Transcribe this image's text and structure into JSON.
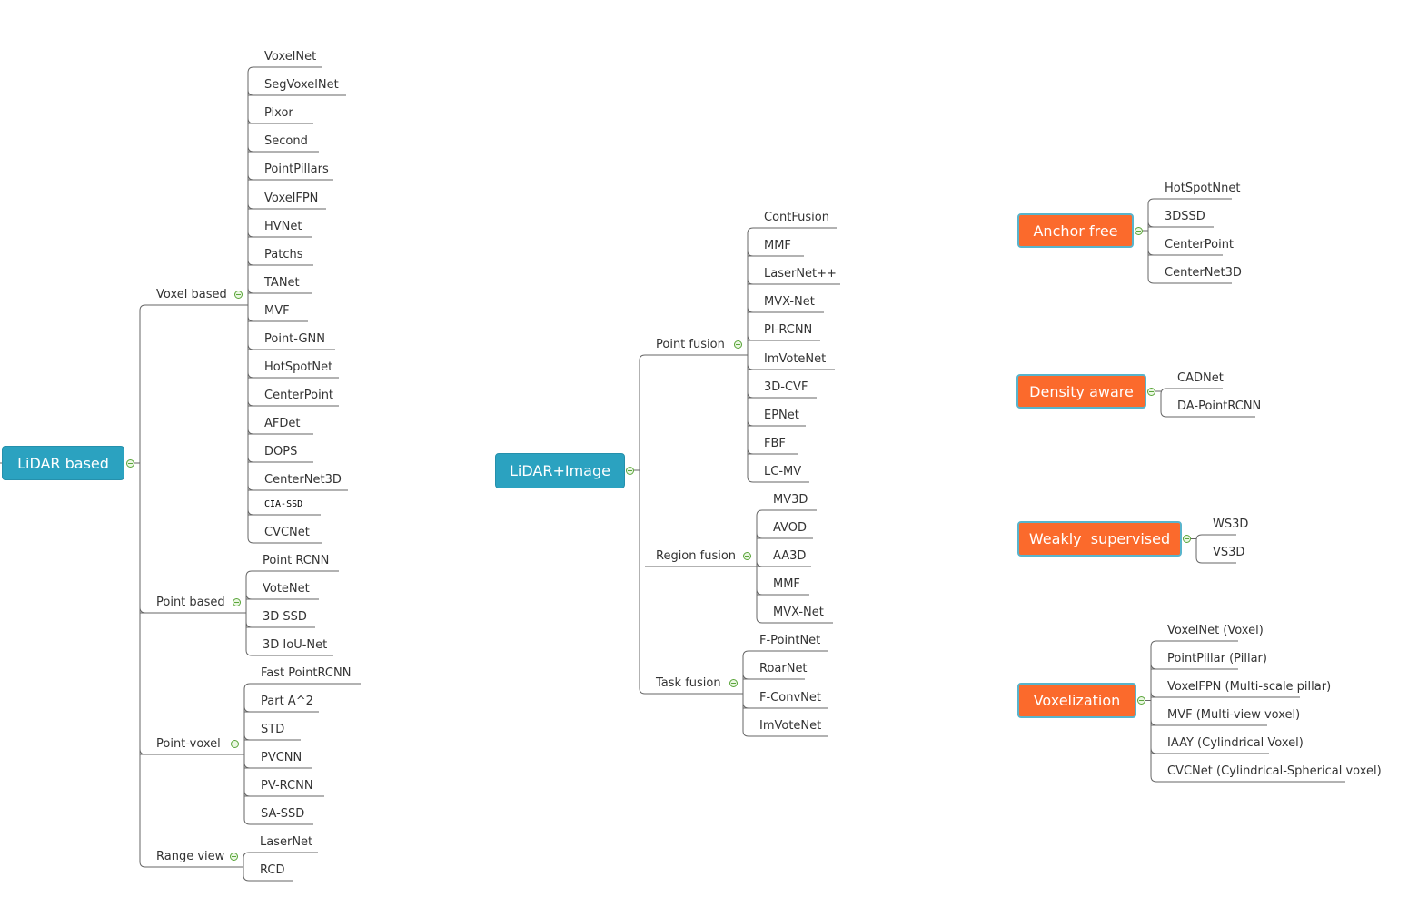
{
  "trees": [
    {
      "id": "lidar-based",
      "label": "LiDAR based",
      "color": "#2ba2c0",
      "groups": [
        {
          "label": "Voxel based",
          "items": [
            "VoxelNet",
            "SegVoxelNet",
            "Pixor",
            "Second",
            "PointPillars",
            "VoxelFPN",
            "HVNet",
            "Patchs",
            "TANet",
            "MVF",
            "Point-GNN",
            "HotSpotNet",
            "CenterPoint",
            "AFDet",
            "DOPS",
            "CenterNet3D",
            "CIA-SSD",
            "CVCNet"
          ]
        },
        {
          "label": "Point based",
          "items": [
            "Point RCNN",
            "VoteNet",
            "3D SSD",
            "3D IoU-Net"
          ]
        },
        {
          "label": "Point-voxel",
          "items": [
            "Fast PointRCNN",
            "Part A^2",
            "STD",
            "PVCNN",
            "PV-RCNN",
            "SA-SSD"
          ]
        },
        {
          "label": "Range view",
          "items": [
            "LaserNet",
            "RCD"
          ]
        }
      ]
    },
    {
      "id": "lidar-image",
      "label": "LiDAR+Image",
      "color": "#2ba2c0",
      "groups": [
        {
          "label": "Point fusion",
          "items": [
            "ContFusion",
            "MMF",
            "LaserNet++",
            "MVX-Net",
            "PI-RCNN",
            "ImVoteNet",
            "3D-CVF",
            "EPNet",
            "FBF",
            "LC-MV"
          ]
        },
        {
          "label": "Region fusion",
          "items": [
            "MV3D",
            "AVOD",
            "AA3D",
            "MMF",
            "MVX-Net"
          ]
        },
        {
          "label": "Task fusion",
          "items": [
            "F-PointNet",
            "RoarNet",
            "F-ConvNet",
            "ImVoteNet"
          ]
        }
      ]
    },
    {
      "id": "anchor-free",
      "label": "Anchor free",
      "color": "#fb6a2c",
      "items": [
        "HotSpotNnet",
        "3DSSD",
        "CenterPoint",
        "CenterNet3D"
      ]
    },
    {
      "id": "density-aware",
      "label": "Density aware",
      "color": "#fb6a2c",
      "items": [
        "CADNet",
        "DA-PointRCNN"
      ]
    },
    {
      "id": "weakly-supervised",
      "label": "Weakly  supervised",
      "color": "#fb6a2c",
      "items": [
        "WS3D",
        "VS3D"
      ]
    },
    {
      "id": "voxelization",
      "label": "Voxelization",
      "color": "#fb6a2c",
      "items": [
        "VoxelNet (Voxel)",
        "PointPillar (Pillar)",
        "VoxelFPN (Multi-scale pillar)",
        "MVF (Multi-view voxel)",
        "IAAY (Cylindrical Voxel)",
        "CVCNet (Cylindrical-Spherical voxel)"
      ]
    }
  ],
  "icons": {
    "collapse": "collapse-minus-icon"
  }
}
